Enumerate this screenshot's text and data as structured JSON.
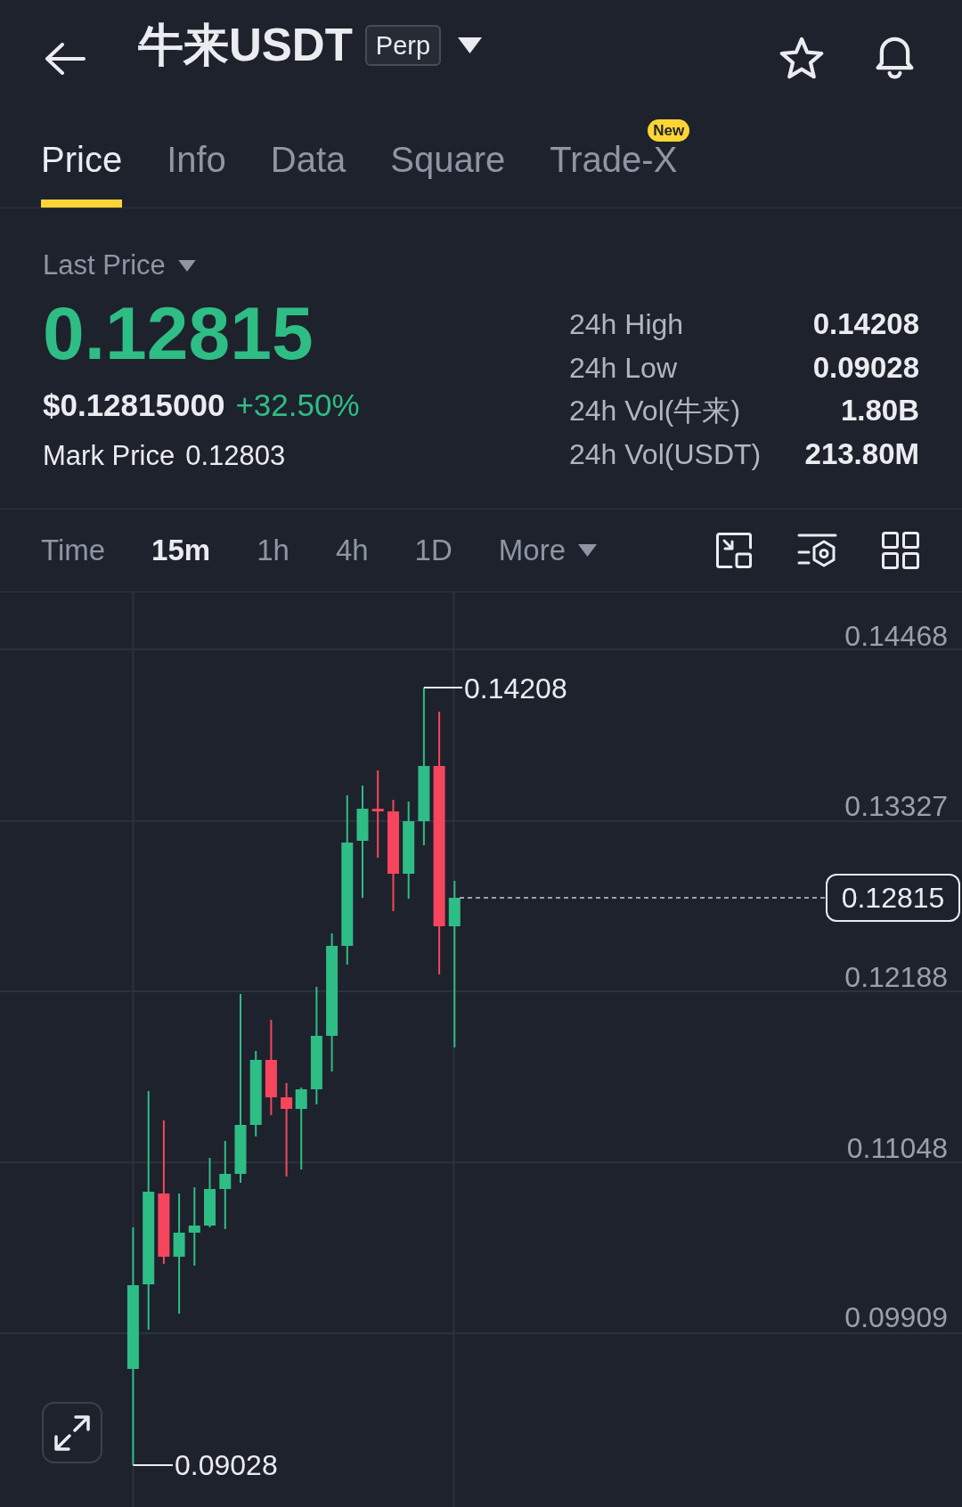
{
  "header": {
    "symbol": "牛来USDT",
    "contract_badge": "Perp"
  },
  "tabs": [
    {
      "label": "Price",
      "selected": true
    },
    {
      "label": "Info",
      "selected": false
    },
    {
      "label": "Data",
      "selected": false
    },
    {
      "label": "Square",
      "selected": false
    },
    {
      "label": "Trade-X",
      "selected": false,
      "badge": "New"
    }
  ],
  "ticker": {
    "label": "Last Price",
    "price_up": true,
    "last_price": "0.12815",
    "usd_price": "$0.12815000",
    "change": "+32.50%",
    "mark_price_label": "Mark Price",
    "mark_price": "0.12803"
  },
  "stats": [
    {
      "label": "24h High",
      "value": "0.14208"
    },
    {
      "label": "24h Low",
      "value": "0.09028"
    },
    {
      "label": "24h Vol(牛来)",
      "value": "1.80B"
    },
    {
      "label": "24h Vol(USDT)",
      "value": "213.80M"
    }
  ],
  "intervals": [
    {
      "label": "Time",
      "kind": "interval",
      "selected": false
    },
    {
      "label": "15m",
      "kind": "interval",
      "selected": true
    },
    {
      "label": "1h",
      "kind": "interval",
      "selected": false
    },
    {
      "label": "4h",
      "kind": "interval",
      "selected": false
    },
    {
      "label": "1D",
      "kind": "interval",
      "selected": false
    },
    {
      "label": "More",
      "kind": "menu",
      "selected": false
    }
  ],
  "chart": {
    "price_axis": [
      "0.14468",
      "0.13327",
      "0.12188",
      "0.11048",
      "0.09909"
    ],
    "high_label": "0.14208",
    "low_label": "0.09028",
    "last_price_tag": "0.12815"
  }
}
